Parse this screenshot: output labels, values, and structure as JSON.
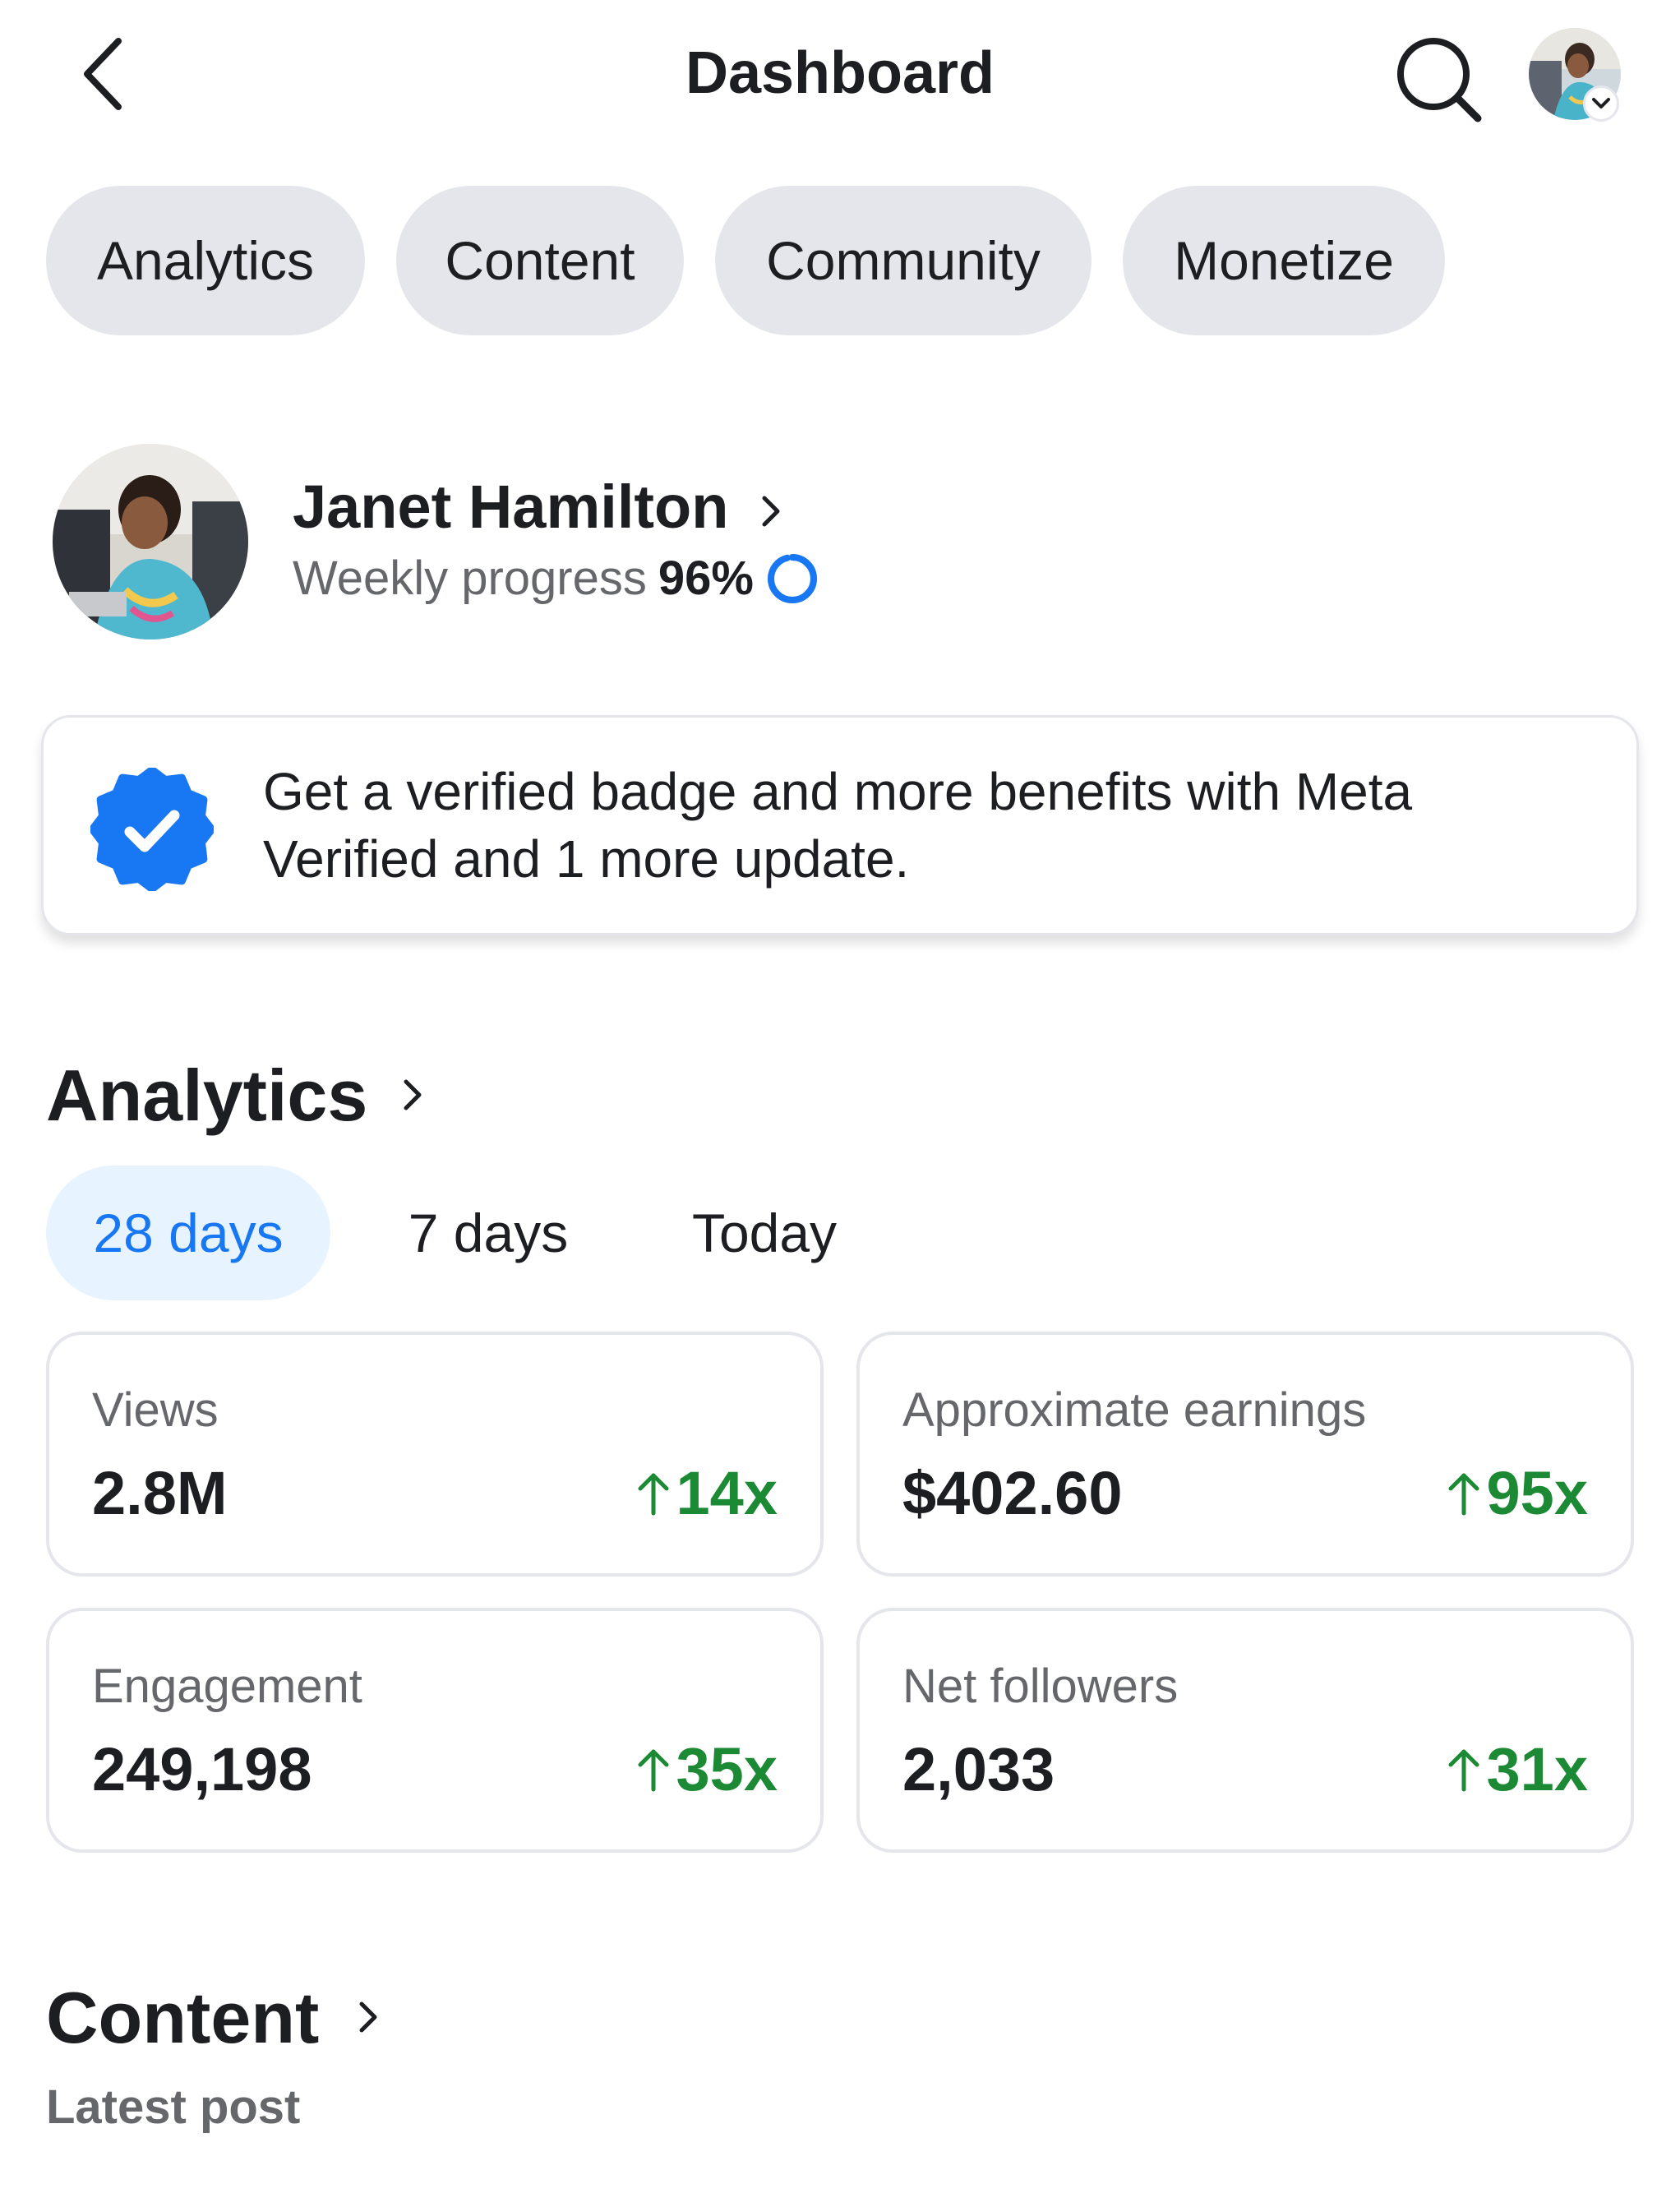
{
  "header": {
    "title": "Dashboard",
    "back_icon": "chevron-left-icon",
    "search_icon": "search-icon",
    "account_avatar_icon": "avatar"
  },
  "tabs": [
    {
      "label": "Analytics"
    },
    {
      "label": "Content"
    },
    {
      "label": "Community"
    },
    {
      "label": "Monetize"
    }
  ],
  "profile": {
    "name": "Janet Hamilton",
    "progress_label": "Weekly progress",
    "progress_value": "96%",
    "progress_fraction": 0.96
  },
  "verified_card": {
    "text": "Get a verified badge and more benefits with Meta Verified and 1 more update.",
    "badge_color": "#1877f2"
  },
  "analytics": {
    "title": "Analytics",
    "ranges": [
      {
        "label": "28 days",
        "selected": true
      },
      {
        "label": "7 days",
        "selected": false
      },
      {
        "label": "Today",
        "selected": false
      }
    ],
    "metrics": [
      {
        "label": "Views",
        "value": "2.8M",
        "change": "14x"
      },
      {
        "label": "Approximate earnings",
        "value": "$402.60",
        "change": "95x"
      },
      {
        "label": "Engagement",
        "value": "249,198",
        "change": "35x"
      },
      {
        "label": "Net followers",
        "value": "2,033",
        "change": "31x"
      }
    ]
  },
  "content": {
    "title": "Content",
    "subtitle": "Latest post"
  },
  "colors": {
    "accent": "#1877f2",
    "positive": "#1c8a34",
    "pill_bg": "#e4e6eb",
    "selected_range_bg": "#e7f3ff"
  }
}
